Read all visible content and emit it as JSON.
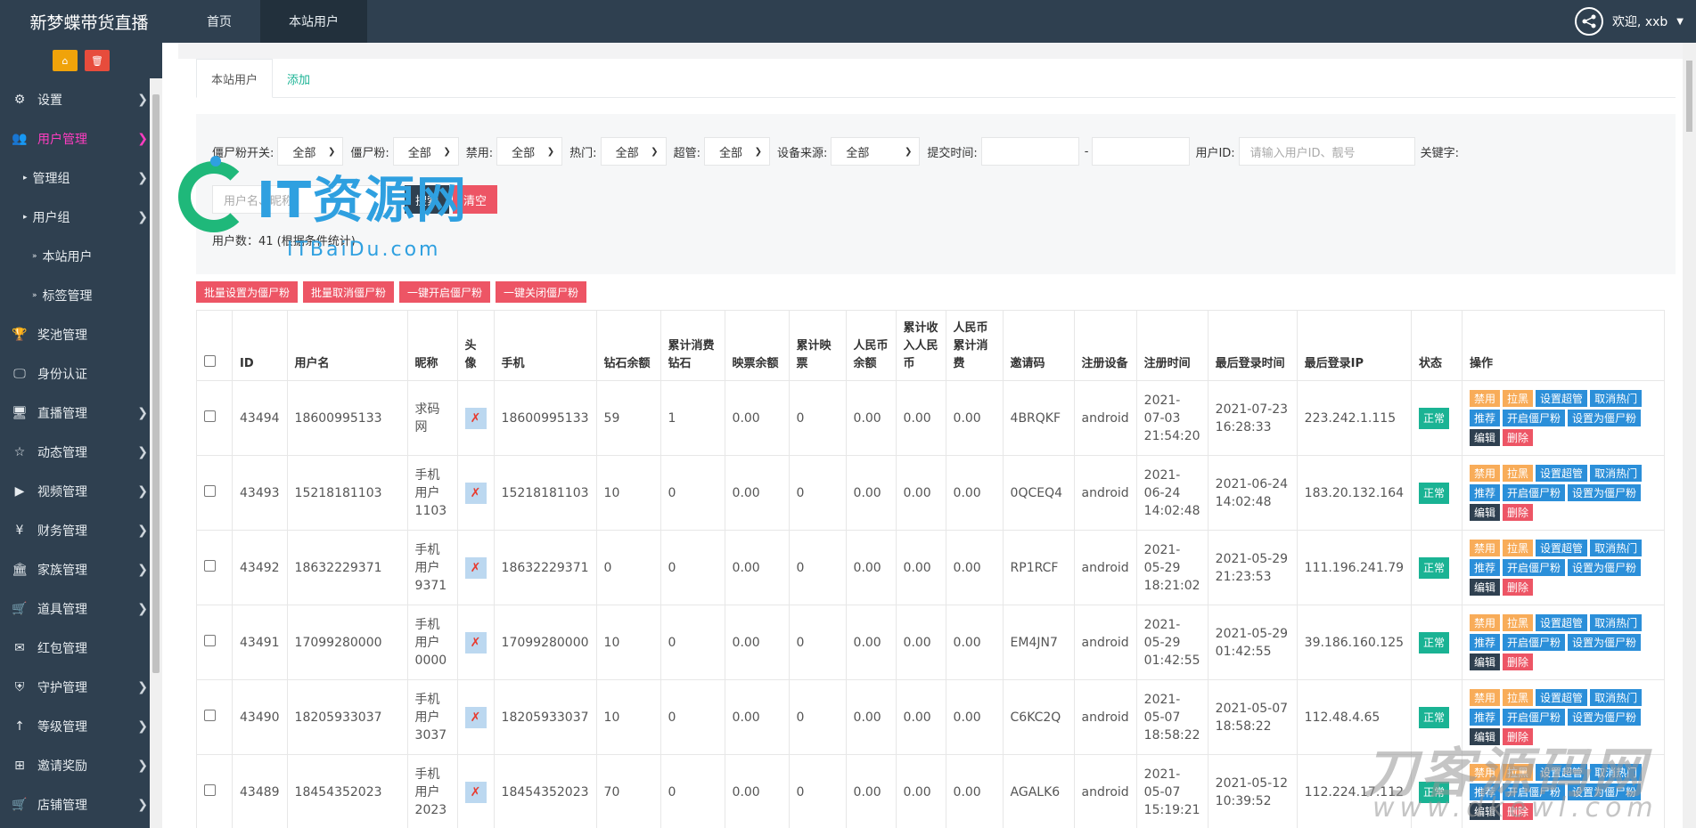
{
  "brand": "新梦蝶带货直播",
  "topnav": [
    {
      "label": "首页",
      "active": false
    },
    {
      "label": "本站用户",
      "active": true
    }
  ],
  "welcome": "欢迎, xxb",
  "sidebar": {
    "items": [
      {
        "label": "设置",
        "icon": "gears-icon",
        "glyph": "⚙",
        "chevron": true,
        "level": 0
      },
      {
        "label": "用户管理",
        "icon": "users-icon",
        "glyph": "👥",
        "chevron": true,
        "level": 0,
        "active": true
      },
      {
        "label": "管理组",
        "icon": "caret-icon",
        "glyph": "▸",
        "chevron": true,
        "level": 1
      },
      {
        "label": "用户组",
        "icon": "caret-icon",
        "glyph": "▸",
        "chevron": true,
        "level": 1
      },
      {
        "label": "本站用户",
        "icon": "double-caret-icon",
        "glyph": "»",
        "chevron": false,
        "level": 2
      },
      {
        "label": "标签管理",
        "icon": "double-caret-icon",
        "glyph": "»",
        "chevron": false,
        "level": 2
      },
      {
        "label": "奖池管理",
        "icon": "trophy-icon",
        "glyph": "🏆",
        "chevron": false,
        "level": 0
      },
      {
        "label": "身份认证",
        "icon": "monitor-icon",
        "glyph": "🖵",
        "chevron": false,
        "level": 0
      },
      {
        "label": "直播管理",
        "icon": "desktop-icon",
        "glyph": "🖥",
        "chevron": true,
        "level": 0
      },
      {
        "label": "动态管理",
        "icon": "star-icon",
        "glyph": "☆",
        "chevron": true,
        "level": 0
      },
      {
        "label": "视频管理",
        "icon": "video-icon",
        "glyph": "▶",
        "chevron": true,
        "level": 0
      },
      {
        "label": "财务管理",
        "icon": "yen-icon",
        "glyph": "¥",
        "chevron": true,
        "level": 0
      },
      {
        "label": "家族管理",
        "icon": "bank-icon",
        "glyph": "🏛",
        "chevron": true,
        "level": 0
      },
      {
        "label": "道具管理",
        "icon": "cart-icon",
        "glyph": "🛒",
        "chevron": true,
        "level": 0
      },
      {
        "label": "红包管理",
        "icon": "envelope-icon",
        "glyph": "✉",
        "chevron": false,
        "level": 0
      },
      {
        "label": "守护管理",
        "icon": "shield-icon",
        "glyph": "⛨",
        "chevron": true,
        "level": 0
      },
      {
        "label": "等级管理",
        "icon": "level-up-icon",
        "glyph": "↑",
        "chevron": true,
        "level": 0
      },
      {
        "label": "邀请奖励",
        "icon": "sitemap-icon",
        "glyph": "⊞",
        "chevron": true,
        "level": 0
      },
      {
        "label": "店铺管理",
        "icon": "cart-icon",
        "glyph": "🛒",
        "chevron": true,
        "level": 0
      }
    ]
  },
  "tabs": [
    {
      "label": "本站用户",
      "active": true
    },
    {
      "label": "添加",
      "active": false
    }
  ],
  "filters": {
    "zombie_switch_label": "僵尸粉开关:",
    "zombie_label": "僵尸粉:",
    "ban_label": "禁用:",
    "hot_label": "热门:",
    "super_label": "超管:",
    "device_label": "设备来源:",
    "time_label": "提交时间:",
    "dash": "-",
    "uid_label": "用户ID:",
    "uid_placeholder": "请输入用户ID、靓号",
    "keyword_label": "关键字:",
    "keyword_placeholder": "用户名、昵称",
    "select_all": "全部",
    "search_btn": "搜索",
    "clear_btn": "清空"
  },
  "count_text": "用户数：41 (根据条件统计)",
  "bulk_buttons": [
    "批量设置为僵尸粉",
    "批量取消僵尸粉",
    "一键开启僵尸粉",
    "一键关闭僵尸粉"
  ],
  "columns": [
    "ID",
    "用户名",
    "昵称",
    "头像",
    "手机",
    "钻石余额",
    "累计消费钻石",
    "映票余额",
    "累计映票",
    "人民币余额",
    "累计收入人民币",
    "人民币累计消费",
    "邀请码",
    "注册设备",
    "注册时间",
    "最后登录时间",
    "最后登录IP",
    "状态",
    "操作"
  ],
  "rows": [
    {
      "id": "43494",
      "username": "18600995133",
      "nickname": "求码网",
      "phone": "18600995133",
      "diamond": "59",
      "diamond_spent": "1",
      "ticket": "0.00",
      "ticket_total": "0",
      "rmb": "0.00",
      "rmb_income": "0.00",
      "rmb_spent": "0.00",
      "invite": "4BRQKF",
      "device": "android",
      "reg_time": "2021-07-03 21:54:20",
      "last_login": "2021-07-23 16:28:33",
      "ip": "223.242.1.115",
      "status": "正常"
    },
    {
      "id": "43493",
      "username": "15218181103",
      "nickname": "手机用户1103",
      "phone": "15218181103",
      "diamond": "10",
      "diamond_spent": "0",
      "ticket": "0.00",
      "ticket_total": "0",
      "rmb": "0.00",
      "rmb_income": "0.00",
      "rmb_spent": "0.00",
      "invite": "0QCEQ4",
      "device": "android",
      "reg_time": "2021-06-24 14:02:48",
      "last_login": "2021-06-24 14:02:48",
      "ip": "183.20.132.164",
      "status": "正常"
    },
    {
      "id": "43492",
      "username": "18632229371",
      "nickname": "手机用户9371",
      "phone": "18632229371",
      "diamond": "0",
      "diamond_spent": "0",
      "ticket": "0.00",
      "ticket_total": "0",
      "rmb": "0.00",
      "rmb_income": "0.00",
      "rmb_spent": "0.00",
      "invite": "RP1RCF",
      "device": "android",
      "reg_time": "2021-05-29 18:21:02",
      "last_login": "2021-05-29 21:23:53",
      "ip": "111.196.241.79",
      "status": "正常"
    },
    {
      "id": "43491",
      "username": "17099280000",
      "nickname": "手机用户0000",
      "phone": "17099280000",
      "diamond": "10",
      "diamond_spent": "0",
      "ticket": "0.00",
      "ticket_total": "0",
      "rmb": "0.00",
      "rmb_income": "0.00",
      "rmb_spent": "0.00",
      "invite": "EM4JN7",
      "device": "android",
      "reg_time": "2021-05-29 01:42:55",
      "last_login": "2021-05-29 01:42:55",
      "ip": "39.186.160.125",
      "status": "正常"
    },
    {
      "id": "43490",
      "username": "18205933037",
      "nickname": "手机用户3037",
      "phone": "18205933037",
      "diamond": "10",
      "diamond_spent": "0",
      "ticket": "0.00",
      "ticket_total": "0",
      "rmb": "0.00",
      "rmb_income": "0.00",
      "rmb_spent": "0.00",
      "invite": "C6KC2Q",
      "device": "android",
      "reg_time": "2021-05-07 18:58:22",
      "last_login": "2021-05-07 18:58:22",
      "ip": "112.48.4.65",
      "status": "正常"
    },
    {
      "id": "43489",
      "username": "18454352023",
      "nickname": "手机用户2023",
      "phone": "18454352023",
      "diamond": "70",
      "diamond_spent": "0",
      "ticket": "0.00",
      "ticket_total": "0",
      "rmb": "0.00",
      "rmb_income": "0.00",
      "rmb_spent": "0.00",
      "invite": "AGALK6",
      "device": "android",
      "reg_time": "2021-05-07 15:19:21",
      "last_login": "2021-05-12 10:39:52",
      "ip": "112.224.17.112",
      "status": "正常"
    }
  ],
  "op_buttons": [
    {
      "label": "禁用",
      "color": "orange",
      "name": "ban-button"
    },
    {
      "label": "拉黑",
      "color": "orange",
      "name": "blacklist-button"
    },
    {
      "label": "设置超管",
      "color": "blue",
      "name": "set-superadmin-button"
    },
    {
      "label": "取消热门",
      "color": "blue",
      "name": "cancel-hot-button"
    },
    {
      "label": "推荐",
      "color": "blue",
      "name": "recommend-button"
    },
    {
      "label": "开启僵尸粉",
      "color": "blue",
      "name": "enable-zombie-button"
    },
    {
      "label": "设置为僵尸粉",
      "color": "blue",
      "name": "set-zombie-button"
    },
    {
      "label": "编辑",
      "color": "dark",
      "name": "edit-button"
    },
    {
      "label": "删除",
      "color": "red",
      "name": "delete-button"
    }
  ],
  "watermark": {
    "main": "IT资源网",
    "sub": "ITBaiDu.com",
    "corner": "刀客源码网",
    "corner_sub": "www.dkewl.com"
  },
  "colors": {
    "sidebar_bg": "#2f4050",
    "accent": "#1ab394",
    "active_menu": "#ff3dc1",
    "danger": "#ed5565",
    "warning": "#f8ac59",
    "info": "#2b8fd9"
  }
}
